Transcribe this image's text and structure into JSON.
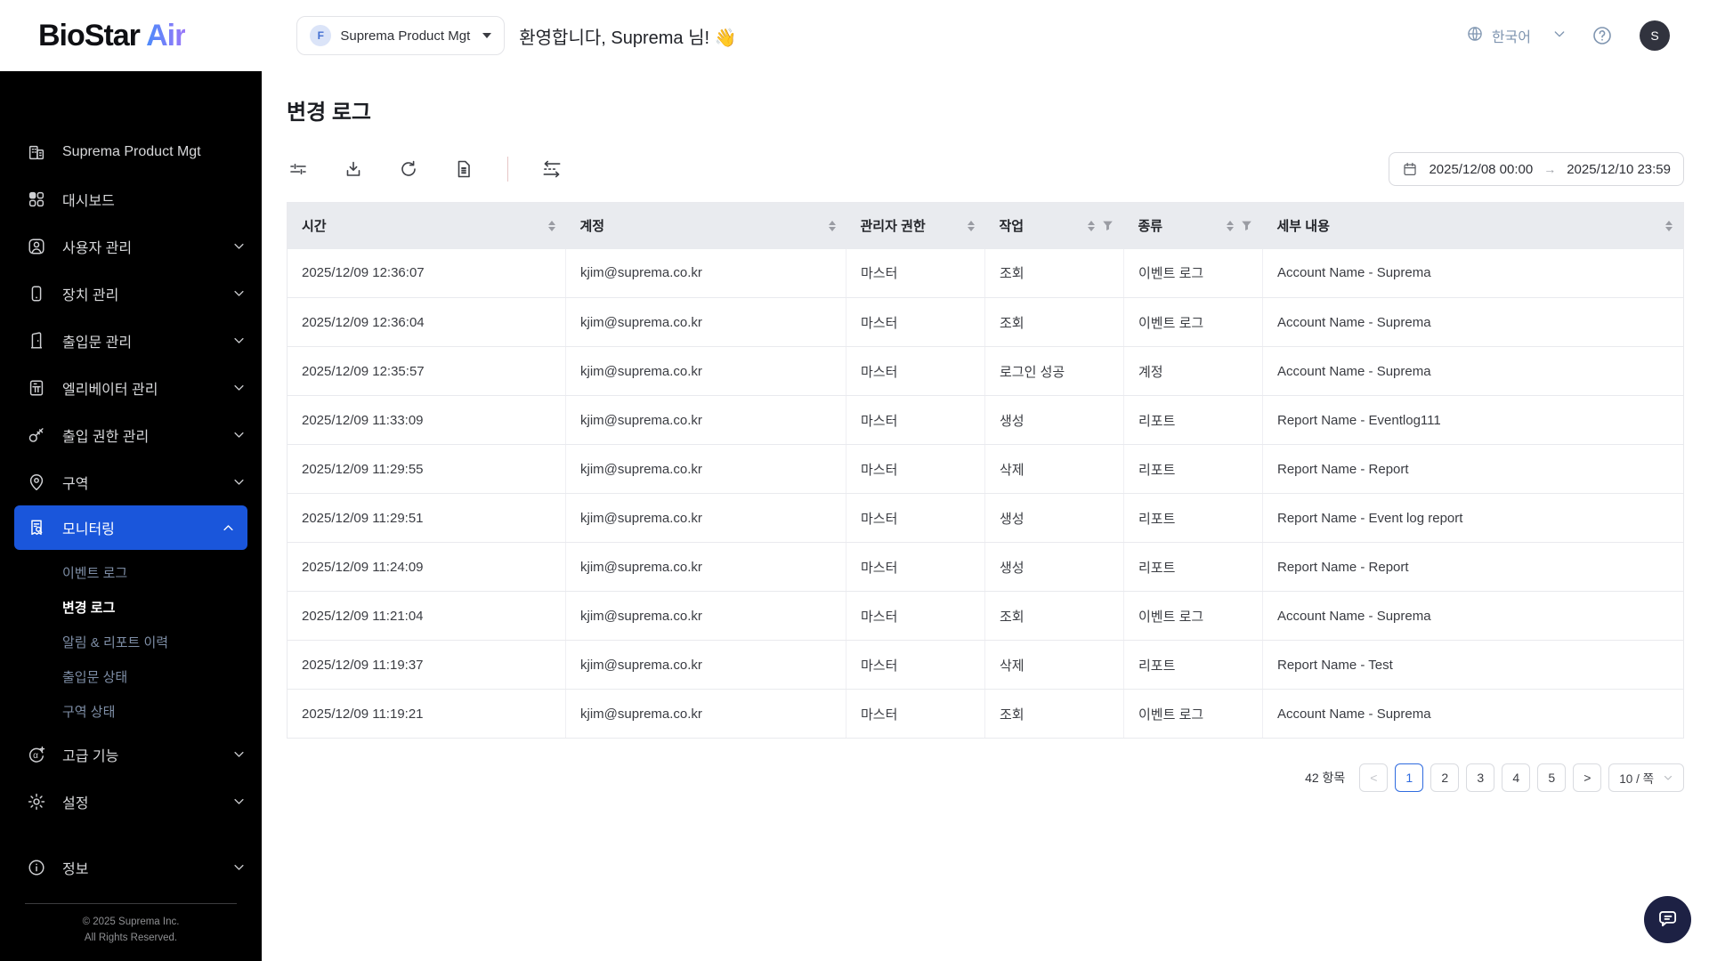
{
  "header": {
    "logo_part1": "BioStar",
    "logo_part2": " Air",
    "org_selector": {
      "badge": "F",
      "label": "Suprema Product Mgt"
    },
    "welcome": "환영합니다, Suprema 님! 👋",
    "language": "한국어",
    "avatar_initial": "S"
  },
  "sidebar": {
    "items": [
      {
        "label": "Suprema Product Mgt",
        "icon": "building-icon"
      },
      {
        "label": "대시보드",
        "icon": "dashboard-icon"
      },
      {
        "label": "사용자 관리",
        "icon": "user-icon"
      },
      {
        "label": "장치 관리",
        "icon": "device-icon"
      },
      {
        "label": "출입문 관리",
        "icon": "door-icon"
      },
      {
        "label": "엘리베이터 관리",
        "icon": "elevator-icon"
      },
      {
        "label": "출입 권한 관리",
        "icon": "key-icon"
      },
      {
        "label": "구역",
        "icon": "location-pin-icon"
      },
      {
        "label": "모니터링",
        "icon": "monitoring-icon"
      },
      {
        "label": "고급 기능",
        "icon": "alpha-plus-icon"
      },
      {
        "label": "설정",
        "icon": "gear-icon"
      },
      {
        "label": "정보",
        "icon": "info-icon"
      }
    ],
    "monitoring_sub": [
      {
        "label": "이벤트 로그"
      },
      {
        "label": "변경 로그"
      },
      {
        "label": "알림 & 리포트 이력"
      },
      {
        "label": "출입문 상태"
      },
      {
        "label": "구역 상태"
      }
    ],
    "footer": {
      "copyright_line1": "© 2025 Suprema Inc.",
      "copyright_line2": "All Rights Reserved."
    }
  },
  "page": {
    "title": "변경 로그",
    "date_range": {
      "start": "2025/12/08 00:00",
      "end": "2025/12/10 23:59"
    }
  },
  "table": {
    "columns": [
      {
        "label": "시간"
      },
      {
        "label": "계정"
      },
      {
        "label": "관리자 권한"
      },
      {
        "label": "작업"
      },
      {
        "label": "종류"
      },
      {
        "label": "세부 내용"
      }
    ],
    "rows": [
      {
        "time": "2025/12/09 12:36:07",
        "account": "kjim@suprema.co.kr",
        "role": "마스터",
        "action": "조회",
        "type": "이벤트 로그",
        "detail": "Account Name - Suprema"
      },
      {
        "time": "2025/12/09 12:36:04",
        "account": "kjim@suprema.co.kr",
        "role": "마스터",
        "action": "조회",
        "type": "이벤트 로그",
        "detail": "Account Name - Suprema"
      },
      {
        "time": "2025/12/09 12:35:57",
        "account": "kjim@suprema.co.kr",
        "role": "마스터",
        "action": "로그인 성공",
        "type": "계정",
        "detail": "Account Name - Suprema"
      },
      {
        "time": "2025/12/09 11:33:09",
        "account": "kjim@suprema.co.kr",
        "role": "마스터",
        "action": "생성",
        "type": "리포트",
        "detail": "Report Name - Eventlog111"
      },
      {
        "time": "2025/12/09 11:29:55",
        "account": "kjim@suprema.co.kr",
        "role": "마스터",
        "action": "삭제",
        "type": "리포트",
        "detail": "Report Name - Report"
      },
      {
        "time": "2025/12/09 11:29:51",
        "account": "kjim@suprema.co.kr",
        "role": "마스터",
        "action": "생성",
        "type": "리포트",
        "detail": "Report Name - Event log report"
      },
      {
        "time": "2025/12/09 11:24:09",
        "account": "kjim@suprema.co.kr",
        "role": "마스터",
        "action": "생성",
        "type": "리포트",
        "detail": "Report Name - Report"
      },
      {
        "time": "2025/12/09 11:21:04",
        "account": "kjim@suprema.co.kr",
        "role": "마스터",
        "action": "조회",
        "type": "이벤트 로그",
        "detail": "Account Name - Suprema"
      },
      {
        "time": "2025/12/09 11:19:37",
        "account": "kjim@suprema.co.kr",
        "role": "마스터",
        "action": "삭제",
        "type": "리포트",
        "detail": "Report Name - Test"
      },
      {
        "time": "2025/12/09 11:19:21",
        "account": "kjim@suprema.co.kr",
        "role": "마스터",
        "action": "조회",
        "type": "이벤트 로그",
        "detail": "Account Name - Suprema"
      }
    ]
  },
  "pagination": {
    "total_label": "42 항목",
    "prev": "<",
    "next": ">",
    "pages": [
      "1",
      "2",
      "3",
      "4",
      "5"
    ],
    "active_page": "1",
    "page_size": "10 / 쪽"
  },
  "colors": {
    "accent_blue": "#1a56db",
    "sidebar_bg": "#000000",
    "table_header_bg": "#e9ebef",
    "chat_fab_bg": "#1d2144"
  }
}
